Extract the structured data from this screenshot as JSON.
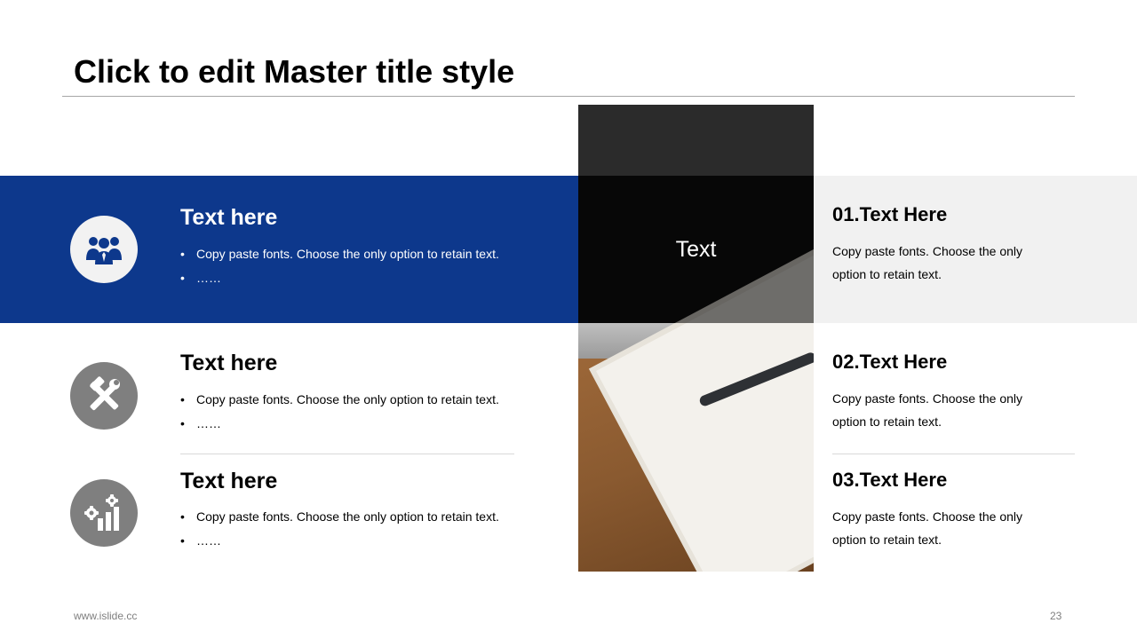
{
  "slide": {
    "title": "Click to edit Master title style",
    "rows": [
      {
        "title": "Text here",
        "icon": "people-icon",
        "bullets": [
          "Copy paste fonts. Choose the only option to retain text.",
          "……"
        ]
      },
      {
        "title": "Text here",
        "icon": "tools-icon",
        "bullets": [
          "Copy paste fonts. Choose the only option to retain text.",
          "……"
        ]
      },
      {
        "title": "Text here",
        "icon": "gear-bar-chart-icon",
        "bullets": [
          "Copy paste fonts. Choose the only option to retain text.",
          "……"
        ]
      }
    ],
    "photo_label": "Text",
    "numbered": [
      {
        "title": "01.Text Here",
        "desc": "Copy paste fonts. Choose the only option to retain text."
      },
      {
        "title": "02.Text Here",
        "desc": "Copy paste fonts. Choose the only option to retain text."
      },
      {
        "title": "03.Text Here",
        "desc": "Copy paste fonts. Choose the only option to retain text."
      }
    ],
    "footer": {
      "url": "www.islide.cc",
      "page": "23"
    },
    "colors": {
      "accent": "#0d388c",
      "icon_gray": "#7f7f7f",
      "panel_gray": "#f1f1f1"
    }
  }
}
